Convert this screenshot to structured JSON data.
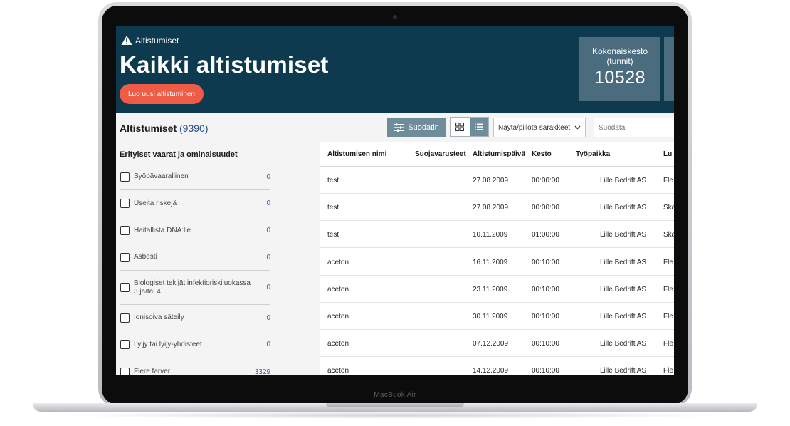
{
  "device": {
    "model_label": "MacBook Air"
  },
  "header": {
    "breadcrumb": "Altistumiset",
    "title": "Kaikki altistumiset",
    "create_button": "Luo uusi altistuminen",
    "stat": {
      "label": "Kokonaiskesto (tunnit)",
      "value": "10528"
    }
  },
  "toolbar": {
    "title": "Altistumiset",
    "count": "(9390)",
    "filter_button": "Suodatin",
    "columns_select": "Näytä/piilota sarakkeet",
    "search_placeholder": "Suodata"
  },
  "sidebar": {
    "heading": "Erityiset vaarat ja ominaisuudet",
    "items": [
      {
        "label": "Syöpävaarallinen",
        "count": "0"
      },
      {
        "label": "Useita riskejä",
        "count": "0"
      },
      {
        "label": "Haitallista DNA:lle",
        "count": "0"
      },
      {
        "label": "Asbesti",
        "count": "0"
      },
      {
        "label": "Biologiset tekijät infektioriskiluokassa 3 ja/tai 4",
        "count": "0"
      },
      {
        "label": "Ionisoiva säteily",
        "count": "0"
      },
      {
        "label": "Lyijy tai lyijy-yhdisteet",
        "count": "0"
      },
      {
        "label": "Flere farver",
        "count": "3329"
      }
    ]
  },
  "table": {
    "columns": [
      "Altistumisen nimi",
      "Suojavarusteet",
      "Altistumispäivä",
      "Kesto",
      "Työpaikka",
      "Lu"
    ],
    "rows": [
      [
        "test",
        "",
        "27.08.2009",
        "00:00:00",
        "Lille Bedrift AS",
        "Fle"
      ],
      [
        "test",
        "",
        "27.08.2009",
        "00:00:00",
        "Lille Bedrift AS",
        "Ska"
      ],
      [
        "test",
        "",
        "10.11.2009",
        "01:00:00",
        "Lille Bedrift AS",
        "Ska"
      ],
      [
        "aceton",
        "",
        "16.11.2009",
        "00:10:00",
        "Lille Bedrift AS",
        "Fle"
      ],
      [
        "aceton",
        "",
        "23.11.2009",
        "00:10:00",
        "Lille Bedrift AS",
        "Fle"
      ],
      [
        "aceton",
        "",
        "30.11.2009",
        "00:10:00",
        "Lille Bedrift AS",
        "Fle"
      ],
      [
        "aceton",
        "",
        "07.12.2009",
        "00:10:00",
        "Lille Bedrift AS",
        "Fle"
      ],
      [
        "aceton",
        "",
        "14.12.2009",
        "00:10:00",
        "Lille Bedrift AS",
        "Fle"
      ]
    ]
  },
  "colors": {
    "header_bg": "#0e3a4f",
    "accent_button": "#ef5b45",
    "stat_card": "#4a6c7e",
    "filter_button": "#6e8c99",
    "count_link": "#3b58a8"
  },
  "icons": {
    "breadcrumb": "warning-icon",
    "filter": "sliders-icon",
    "grid_view": "grid-icon",
    "list_view": "list-icon",
    "select": "chevron-down-icon"
  }
}
